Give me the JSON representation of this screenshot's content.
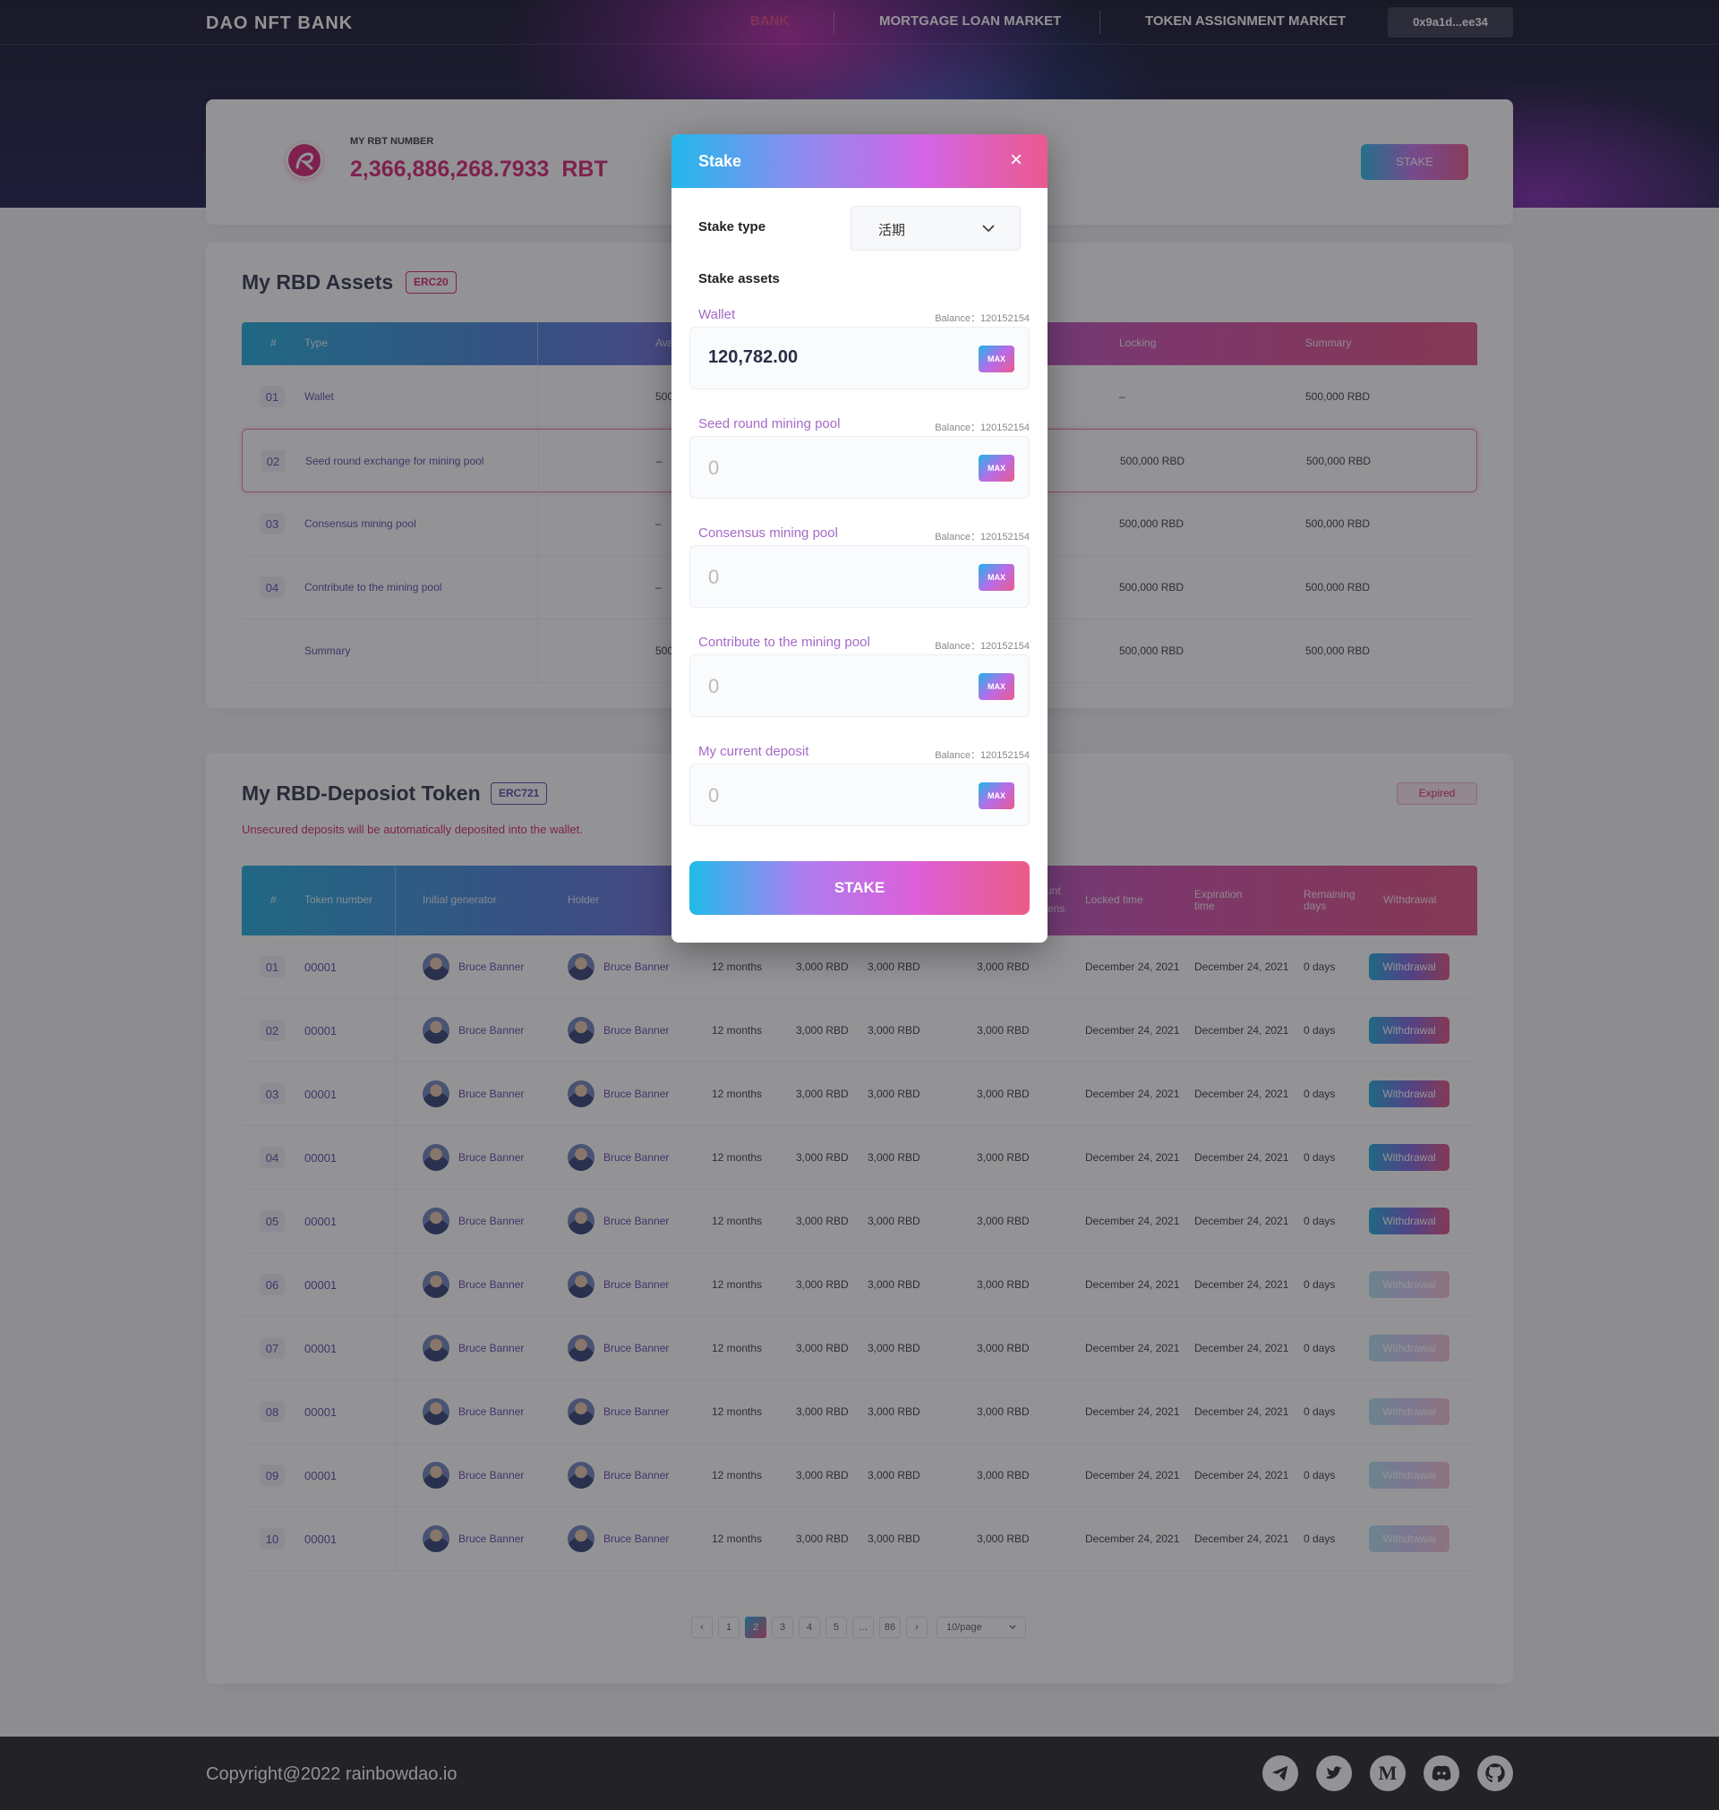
{
  "header": {
    "logo": "DAO NFT BANK",
    "nav": [
      "BANK",
      "MORTGAGE LOAN MARKET",
      "TOKEN ASSIGNMENT MARKET"
    ],
    "active_nav": "BANK",
    "wallet": "0x9a1d...ee34"
  },
  "rbt": {
    "label": "MY RBT NUMBER",
    "amount": "2,366,886,268.7933",
    "unit": "RBT",
    "stake_button": "STAKE"
  },
  "assets": {
    "title": "My RBD Assets",
    "tag": "ERC20",
    "columns": [
      "#",
      "Type",
      "Ava",
      "Locking",
      "Summary"
    ],
    "rows": [
      {
        "num": "01",
        "type": "Wallet",
        "available": "500",
        "locking": "–",
        "summary": "500,000 RBD"
      },
      {
        "num": "02",
        "type": "Seed round exchange for mining pool",
        "available": "–",
        "locking": "500,000 RBD",
        "summary": "500,000 RBD"
      },
      {
        "num": "03",
        "type": "Consensus mining pool",
        "available": "–",
        "locking": "500,000 RBD",
        "summary": "500,000 RBD"
      },
      {
        "num": "04",
        "type": "Contribute to the mining pool",
        "available": "–",
        "locking": "500,000 RBD",
        "summary": "500,000 RBD"
      },
      {
        "num": "",
        "type": "Summary",
        "available": "500",
        "locking": "500,000 RBD",
        "summary": "500,000 RBD"
      }
    ]
  },
  "tokens": {
    "title": "My RBD-Deposiot Token",
    "tag": "ERC721",
    "expired": "Expired",
    "notice": "Unsecured deposits will be automatically deposited into the wallet.",
    "columns": [
      "#",
      "Token number",
      "Initial generator",
      "Holder",
      "unt",
      "ens",
      "Locked time",
      "Expiration time",
      "Remaining days",
      "Withdrawal"
    ],
    "rows": [
      {
        "num": "01",
        "token": "00001",
        "generator": "Bruce Banner",
        "holder": "Bruce Banner",
        "term": "12 months",
        "a1": "3,000 RBD",
        "a2": "3,000 RBD",
        "a3": "3,000 RBD",
        "locked": "December 24, 2021",
        "expires": "December 24, 2021",
        "remaining": "0 days",
        "action": "Withdrawal",
        "enabled": true
      },
      {
        "num": "02",
        "token": "00001",
        "generator": "Bruce Banner",
        "holder": "Bruce Banner",
        "term": "12 months",
        "a1": "3,000 RBD",
        "a2": "3,000 RBD",
        "a3": "3,000 RBD",
        "locked": "December 24, 2021",
        "expires": "December 24, 2021",
        "remaining": "0 days",
        "action": "Withdrawal",
        "enabled": true
      },
      {
        "num": "03",
        "token": "00001",
        "generator": "Bruce Banner",
        "holder": "Bruce Banner",
        "term": "12 months",
        "a1": "3,000 RBD",
        "a2": "3,000 RBD",
        "a3": "3,000 RBD",
        "locked": "December 24, 2021",
        "expires": "December 24, 2021",
        "remaining": "0 days",
        "action": "Withdrawal",
        "enabled": true
      },
      {
        "num": "04",
        "token": "00001",
        "generator": "Bruce Banner",
        "holder": "Bruce Banner",
        "term": "12 months",
        "a1": "3,000 RBD",
        "a2": "3,000 RBD",
        "a3": "3,000 RBD",
        "locked": "December 24, 2021",
        "expires": "December 24, 2021",
        "remaining": "0 days",
        "action": "Withdrawal",
        "enabled": true
      },
      {
        "num": "05",
        "token": "00001",
        "generator": "Bruce Banner",
        "holder": "Bruce Banner",
        "term": "12 months",
        "a1": "3,000 RBD",
        "a2": "3,000 RBD",
        "a3": "3,000 RBD",
        "locked": "December 24, 2021",
        "expires": "December 24, 2021",
        "remaining": "0 days",
        "action": "Withdrawal",
        "enabled": true
      },
      {
        "num": "06",
        "token": "00001",
        "generator": "Bruce Banner",
        "holder": "Bruce Banner",
        "term": "12 months",
        "a1": "3,000 RBD",
        "a2": "3,000 RBD",
        "a3": "3,000 RBD",
        "locked": "December 24, 2021",
        "expires": "December 24, 2021",
        "remaining": "0 days",
        "action": "Withdrawal",
        "enabled": false
      },
      {
        "num": "07",
        "token": "00001",
        "generator": "Bruce Banner",
        "holder": "Bruce Banner",
        "term": "12 months",
        "a1": "3,000 RBD",
        "a2": "3,000 RBD",
        "a3": "3,000 RBD",
        "locked": "December 24, 2021",
        "expires": "December 24, 2021",
        "remaining": "0 days",
        "action": "Withdrawal",
        "enabled": false
      },
      {
        "num": "08",
        "token": "00001",
        "generator": "Bruce Banner",
        "holder": "Bruce Banner",
        "term": "12 months",
        "a1": "3,000 RBD",
        "a2": "3,000 RBD",
        "a3": "3,000 RBD",
        "locked": "December 24, 2021",
        "expires": "December 24, 2021",
        "remaining": "0 days",
        "action": "Withdrawal",
        "enabled": false
      },
      {
        "num": "09",
        "token": "00001",
        "generator": "Bruce Banner",
        "holder": "Bruce Banner",
        "term": "12 months",
        "a1": "3,000 RBD",
        "a2": "3,000 RBD",
        "a3": "3,000 RBD",
        "locked": "December 24, 2021",
        "expires": "December 24, 2021",
        "remaining": "0 days",
        "action": "Withdrawal",
        "enabled": false
      },
      {
        "num": "10",
        "token": "00001",
        "generator": "Bruce Banner",
        "holder": "Bruce Banner",
        "term": "12 months",
        "a1": "3,000 RBD",
        "a2": "3,000 RBD",
        "a3": "3,000 RBD",
        "locked": "December 24, 2021",
        "expires": "December 24, 2021",
        "remaining": "0 days",
        "action": "Withdrawal",
        "enabled": false
      }
    ]
  },
  "pagination": {
    "prev": "‹",
    "next": "›",
    "pages": [
      "1",
      "2",
      "3",
      "4",
      "5",
      "…",
      "86"
    ],
    "current": "2",
    "per_page": "10/page"
  },
  "footer": {
    "copyright": "Copyright@2022 rainbowdao.io",
    "social": [
      "telegram-icon",
      "twitter-icon",
      "medium-icon",
      "discord-icon",
      "github-icon"
    ]
  },
  "modal": {
    "title": "Stake",
    "close": "×",
    "stake_type_label": "Stake type",
    "stake_type_value": "活期",
    "assets_label": "Stake assets",
    "max_label": "MAX",
    "submit": "STAKE",
    "assets": [
      {
        "name": "Wallet",
        "balance": "Balance：120152154",
        "value": "120,782.00"
      },
      {
        "name": "Seed round mining pool",
        "balance": "Balance：120152154",
        "value": "0"
      },
      {
        "name": "Consensus mining pool",
        "balance": "Balance：120152154",
        "value": "0"
      },
      {
        "name": "Contribute to the mining pool",
        "balance": "Balance：120152154",
        "value": "0"
      },
      {
        "name": "My current deposit",
        "balance": "Balance：120152154",
        "value": "0"
      }
    ]
  },
  "colors": {
    "accent_pink": "#d41a6e",
    "accent_purple": "#5a3fa0",
    "gradient_start": "#1aa8d8",
    "gradient_end": "#e24a7a"
  }
}
